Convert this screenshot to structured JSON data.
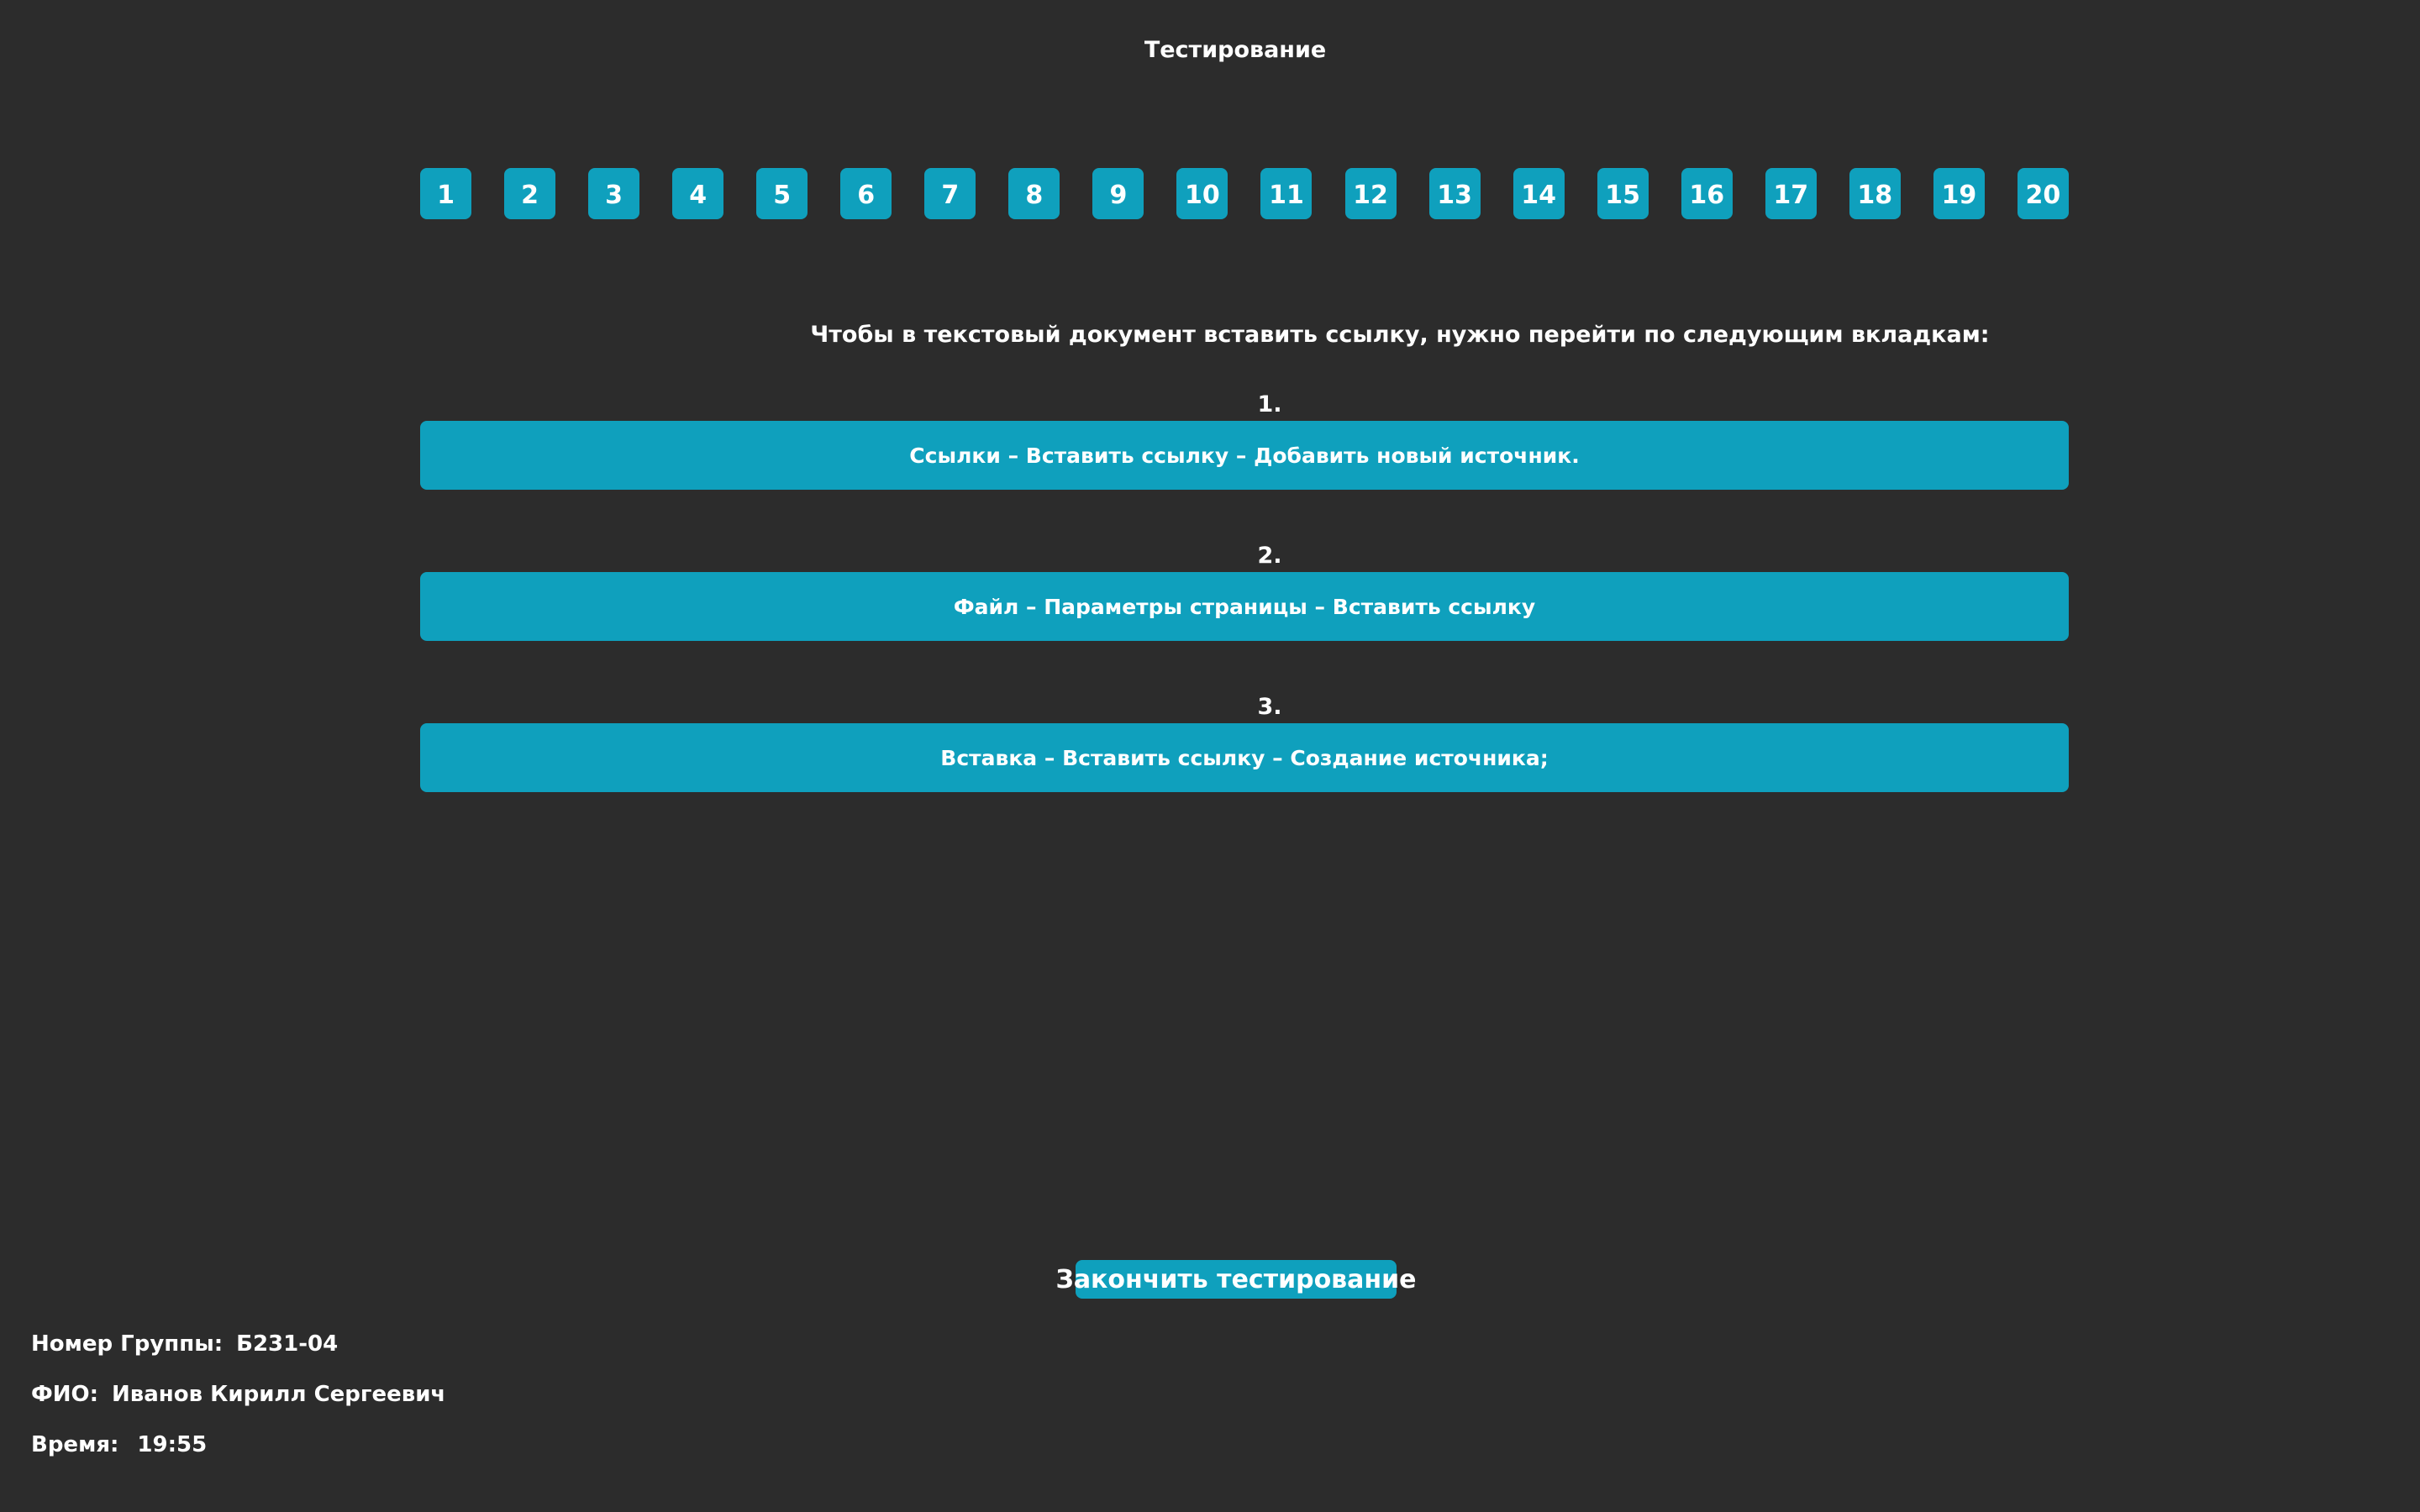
{
  "header": {
    "title": "Тестирование"
  },
  "question_nav": {
    "items": [
      "1",
      "2",
      "3",
      "4",
      "5",
      "6",
      "7",
      "8",
      "9",
      "10",
      "11",
      "12",
      "13",
      "14",
      "15",
      "16",
      "17",
      "18",
      "19",
      "20"
    ]
  },
  "question": {
    "text": "Чтобы в текстовый документ вставить ссылку, нужно перейти по следующим вкладкам:"
  },
  "answers": [
    {
      "number": "1.",
      "text": "Ссылки – Вставить ссылку – Добавить новый источник."
    },
    {
      "number": "2.",
      "text": "Файл – Параметры страницы – Вставить ссылку"
    },
    {
      "number": "3.",
      "text": "Вставка – Вставить ссылку – Создание источника;"
    }
  ],
  "footer": {
    "finish_label": "Закончить тестирование",
    "group_label": "Номер Группы:",
    "group_value": "Б231-04",
    "name_label": "ФИО:",
    "name_value": "Иванов Кирилл Сергеевич",
    "time_label": "Время:",
    "time_value": "19:55"
  },
  "colors": {
    "background": "#2c2c2c",
    "accent": "#0fa0bd",
    "text": "#ffffff"
  }
}
